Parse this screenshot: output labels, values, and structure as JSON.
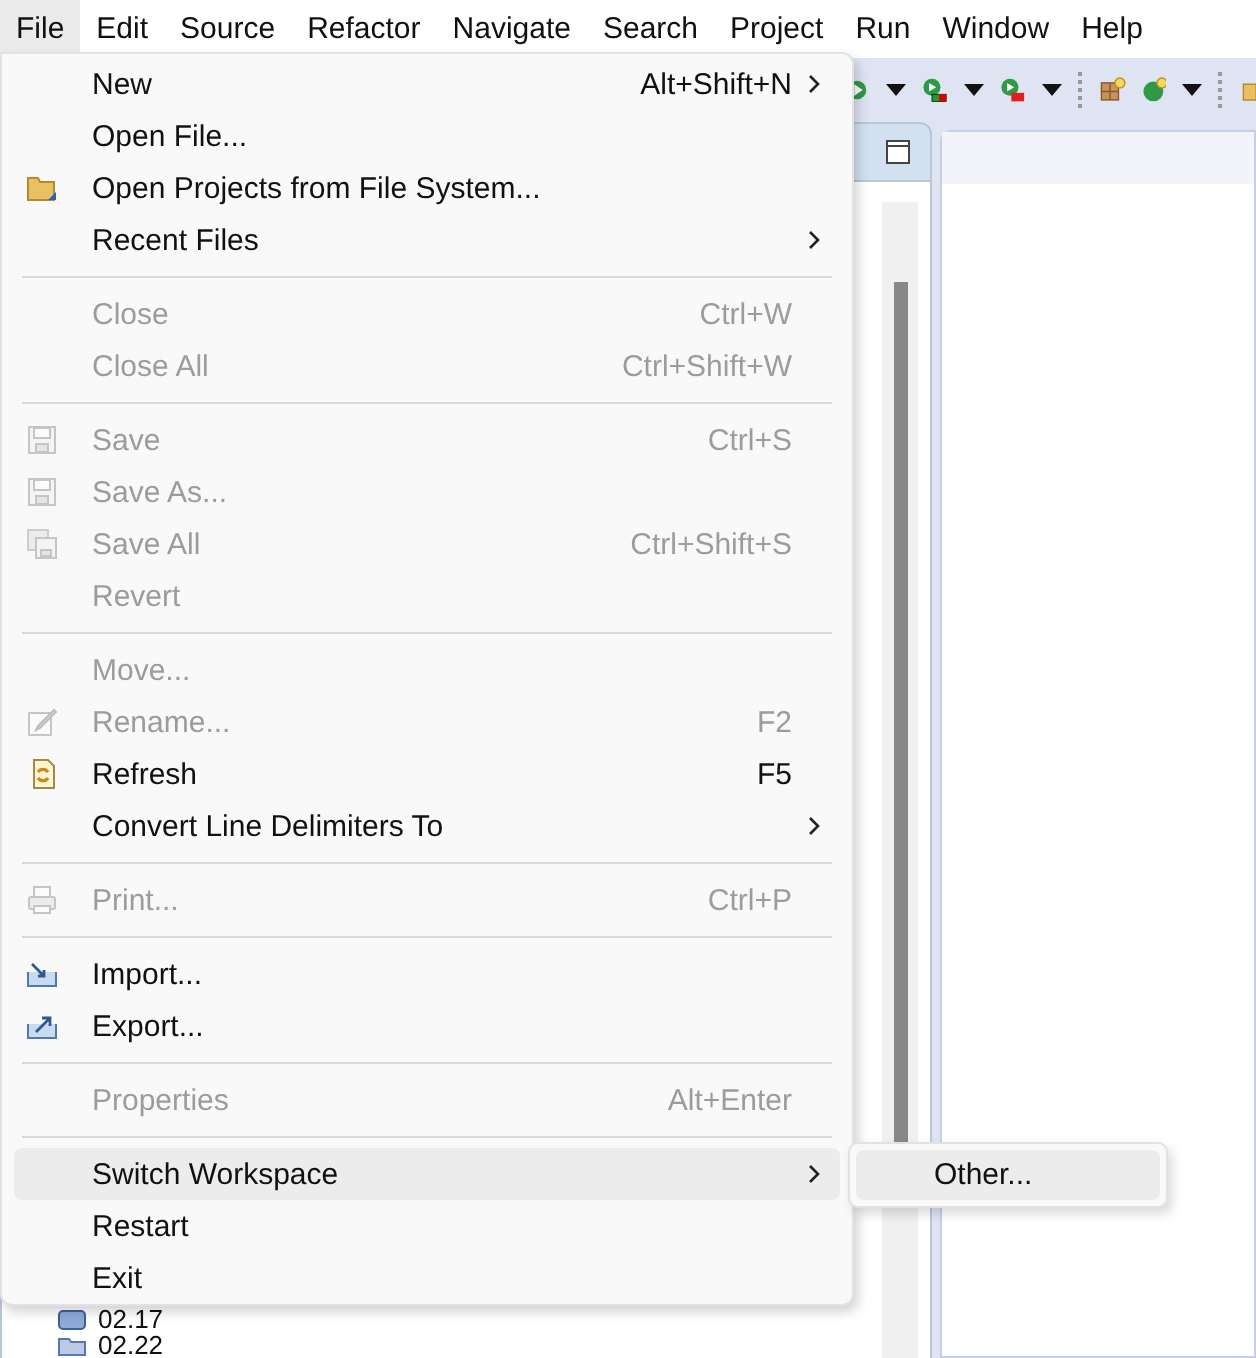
{
  "menubar": [
    {
      "label": "File",
      "selected": true
    },
    {
      "label": "Edit",
      "selected": false
    },
    {
      "label": "Source",
      "selected": false
    },
    {
      "label": "Refactor",
      "selected": false
    },
    {
      "label": "Navigate",
      "selected": false
    },
    {
      "label": "Search",
      "selected": false
    },
    {
      "label": "Project",
      "selected": false
    },
    {
      "label": "Run",
      "selected": false
    },
    {
      "label": "Window",
      "selected": false
    },
    {
      "label": "Help",
      "selected": false
    }
  ],
  "file_menu": [
    {
      "kind": "item",
      "label": "New",
      "shortcut": "Alt+Shift+N",
      "submenu": true,
      "disabled": false,
      "selected": false
    },
    {
      "kind": "item",
      "label": "Open File...",
      "disabled": false,
      "selected": false
    },
    {
      "kind": "item",
      "label": "Open Projects from File System...",
      "disabled": false,
      "selected": false
    },
    {
      "kind": "item",
      "label": "Recent Files",
      "submenu": true,
      "disabled": false,
      "selected": false
    },
    {
      "kind": "separator"
    },
    {
      "kind": "item",
      "label": "Close",
      "shortcut": "Ctrl+W",
      "disabled": true,
      "selected": false
    },
    {
      "kind": "item",
      "label": "Close All",
      "shortcut": "Ctrl+Shift+W",
      "disabled": true,
      "selected": false
    },
    {
      "kind": "separator"
    },
    {
      "kind": "item",
      "label": "Save",
      "shortcut": "Ctrl+S",
      "disabled": true,
      "selected": false
    },
    {
      "kind": "item",
      "label": "Save As...",
      "disabled": true,
      "selected": false
    },
    {
      "kind": "item",
      "label": "Save All",
      "shortcut": "Ctrl+Shift+S",
      "disabled": true,
      "selected": false
    },
    {
      "kind": "item",
      "label": "Revert",
      "disabled": true,
      "selected": false
    },
    {
      "kind": "separator"
    },
    {
      "kind": "item",
      "label": "Move...",
      "disabled": true,
      "selected": false
    },
    {
      "kind": "item",
      "label": "Rename...",
      "shortcut": "F2",
      "disabled": true,
      "selected": false
    },
    {
      "kind": "item",
      "label": "Refresh",
      "shortcut": "F5",
      "disabled": false,
      "selected": false
    },
    {
      "kind": "item",
      "label": "Convert Line Delimiters To",
      "submenu": true,
      "disabled": false,
      "selected": false
    },
    {
      "kind": "separator"
    },
    {
      "kind": "item",
      "label": "Print...",
      "shortcut": "Ctrl+P",
      "disabled": true,
      "selected": false
    },
    {
      "kind": "separator"
    },
    {
      "kind": "item",
      "label": "Import...",
      "disabled": false,
      "selected": false
    },
    {
      "kind": "item",
      "label": "Export...",
      "disabled": false,
      "selected": false
    },
    {
      "kind": "separator"
    },
    {
      "kind": "item",
      "label": "Properties",
      "shortcut": "Alt+Enter",
      "disabled": true,
      "selected": false
    },
    {
      "kind": "separator"
    },
    {
      "kind": "item",
      "label": "Switch Workspace",
      "submenu": true,
      "disabled": false,
      "selected": true
    },
    {
      "kind": "item",
      "label": "Restart",
      "disabled": false,
      "selected": false
    },
    {
      "kind": "item",
      "label": "Exit",
      "disabled": false,
      "selected": false
    }
  ],
  "submenu": [
    {
      "label": "Other...",
      "selected": true
    }
  ],
  "tree": {
    "items": [
      {
        "label": "02.17"
      },
      {
        "label": "02.22"
      }
    ]
  }
}
